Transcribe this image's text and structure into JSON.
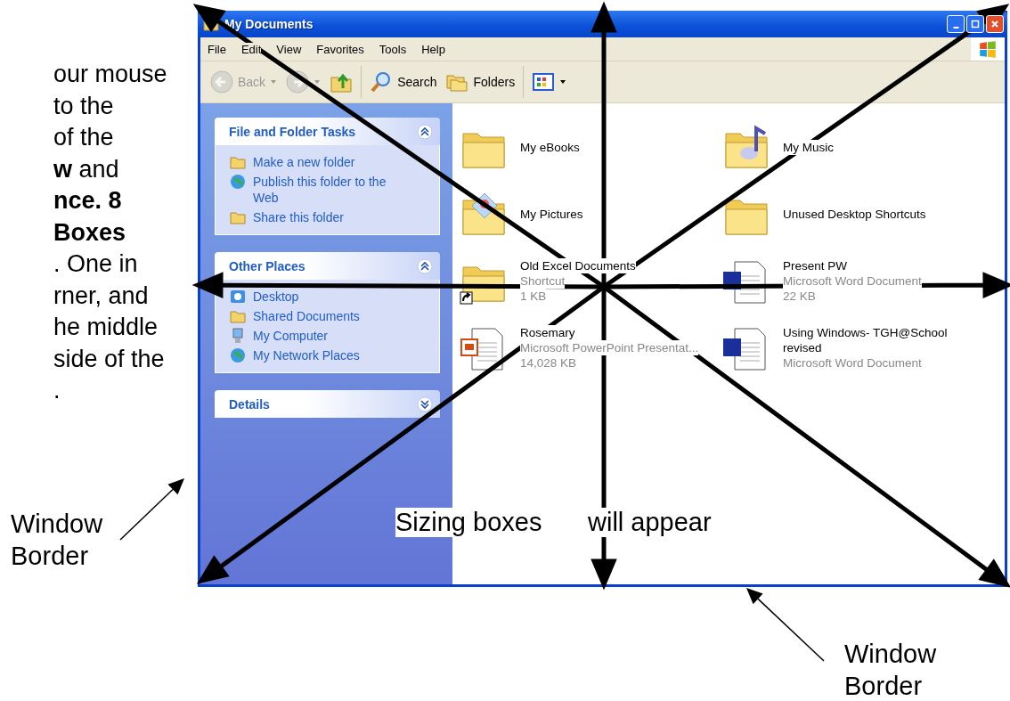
{
  "instructions": {
    "lines": [
      {
        "text": "our mouse",
        "bold": false
      },
      {
        "text": "to the",
        "bold": false
      },
      {
        "text": "of the",
        "bold": false
      },
      {
        "text": "**w** and",
        "bold": false
      },
      {
        "text": "nce.  8",
        "bold": true
      },
      {
        "text": "Boxes",
        "bold": true
      },
      {
        "text": ". One in",
        "bold": false
      },
      {
        "text": "rner, and",
        "bold": false
      },
      {
        "text": "he middle",
        "bold": false
      },
      {
        "text": "side of the",
        "bold": false
      },
      {
        "text": ".",
        "bold": false
      }
    ]
  },
  "window": {
    "title": "My Documents",
    "menu": [
      "File",
      "Edit",
      "View",
      "Favorites",
      "Tools",
      "Help"
    ],
    "toolbar": [
      {
        "kind": "back",
        "label": "Back",
        "disabled": true
      },
      {
        "kind": "forward",
        "disabled": true
      },
      {
        "kind": "up",
        "disabled": false
      },
      {
        "kind": "search",
        "label": "Search",
        "disabled": false
      },
      {
        "kind": "folders",
        "label": "Folders",
        "disabled": false
      },
      {
        "kind": "views",
        "disabled": false
      }
    ],
    "sidebar": [
      {
        "title": "File and Folder Tasks",
        "expanded": true,
        "items": [
          {
            "kind": "newfolder",
            "label": "Make a new folder"
          },
          {
            "kind": "globe",
            "label": "Publish this folder to the Web"
          },
          {
            "kind": "share",
            "label": "Share this folder"
          }
        ]
      },
      {
        "title": "Other Places",
        "expanded": true,
        "items": [
          {
            "kind": "desktop",
            "label": "Desktop"
          },
          {
            "kind": "folder",
            "label": "Shared Documents"
          },
          {
            "kind": "computer",
            "label": "My Computer"
          },
          {
            "kind": "network",
            "label": "My Network Places"
          }
        ]
      },
      {
        "title": "Details",
        "expanded": false
      }
    ],
    "files": [
      {
        "kind": "folder",
        "name": "My eBooks"
      },
      {
        "kind": "music",
        "name": "My Music"
      },
      {
        "kind": "pictures",
        "name": "My Pictures"
      },
      {
        "kind": "folder",
        "name": "Unused Desktop Shortcuts"
      },
      {
        "kind": "shortcut",
        "name": "Old Excel Documents",
        "details": [
          "Shortcut",
          "1 KB"
        ]
      },
      {
        "kind": "word",
        "name": "Present PW",
        "details": [
          "Microsoft Word Document",
          "22 KB"
        ]
      },
      {
        "kind": "powerpoint",
        "name": "Rosemary",
        "details": [
          "Microsoft PowerPoint Presentat...",
          "14,028 KB"
        ]
      },
      {
        "kind": "word",
        "name": "Using Windows- TGH@School revised",
        "details": [
          "Microsoft Word Document"
        ]
      }
    ]
  },
  "caption": [
    "Sizing boxes",
    "will appear"
  ],
  "border_labels": [
    "Window Border",
    "Window Border"
  ]
}
